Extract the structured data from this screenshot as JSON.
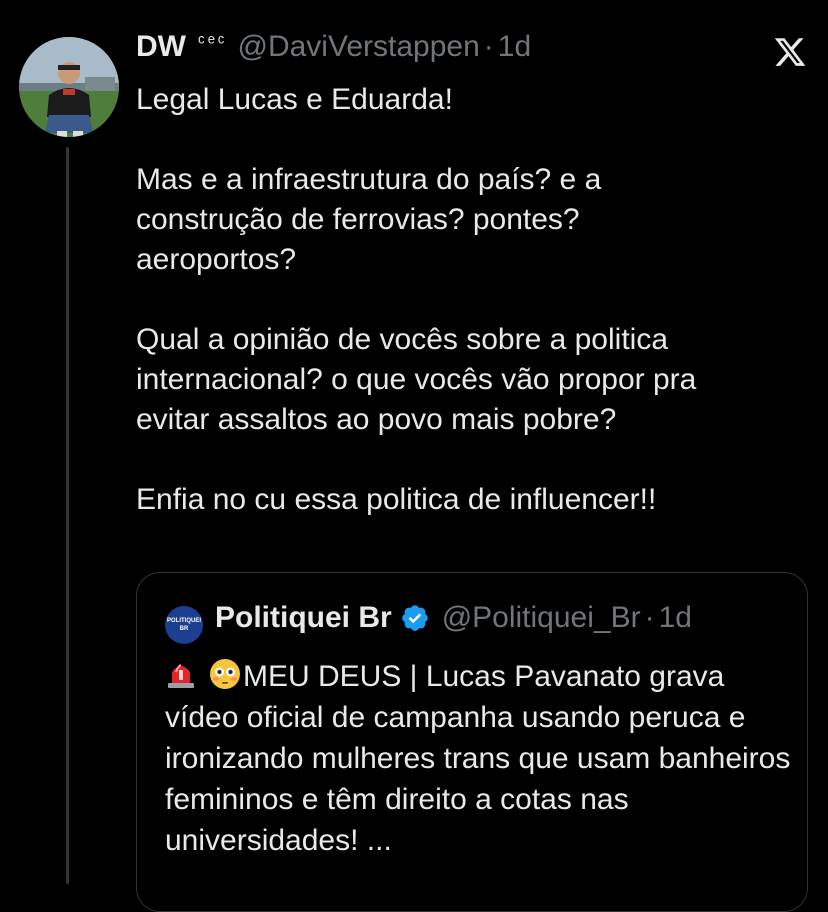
{
  "tweet": {
    "display_name": "DW",
    "name_suffix": "ᶜᵉᶜ",
    "handle": "@DaviVerstappen",
    "separator": "·",
    "time": "1d",
    "text": "Legal Lucas e Eduarda!\n\nMas e a infraestrutura do país? e a\nconstrução de ferrovias? pontes?\naeroportos?\n\nQual a opinião de vocês sobre a politica\ninternacional? o que vocês vão propor pra\nevitar assaltos ao povo mais pobre?\n\nEnfia no cu essa politica de influencer!!"
  },
  "quote": {
    "avatar_text_top": "POLITIQUEI",
    "avatar_text_bottom": "BR",
    "display_name": "Politiquei Br",
    "verified": true,
    "handle": "@Politiquei_Br",
    "separator": "·",
    "time": "1d",
    "leading_icons": [
      "siren-emoji",
      "flushed-face-emoji"
    ],
    "text": "MEU DEUS | Lucas Pavanato grava vídeo oficial de campanha usando peruca e ironizando mulheres trans que usam banheiros femininos e têm direito a cotas nas universidades! ..."
  },
  "icons": {
    "close": "x-logo-icon",
    "verified": "verified-badge-icon"
  },
  "colors": {
    "background": "#000000",
    "text": "#e7e9ea",
    "muted": "#71767b",
    "border": "#2f3336",
    "verified": "#1d9bf0"
  }
}
